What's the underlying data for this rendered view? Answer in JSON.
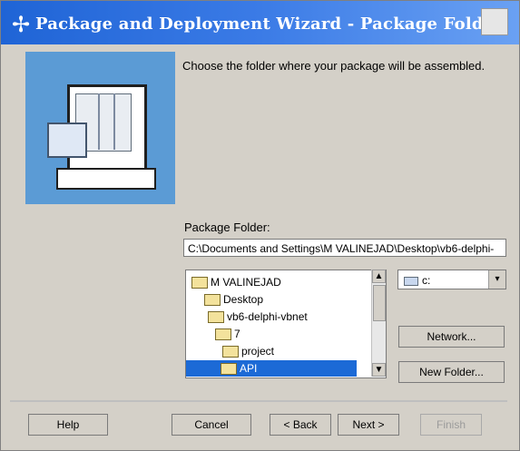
{
  "window": {
    "title": "Package and Deployment Wizard - Package Folder",
    "app_icon": "gear-plus-icon",
    "close_icon": "close-icon"
  },
  "content": {
    "instruction": "Choose the folder where your package will be assembled.",
    "package_folder_label": "Package Folder:",
    "package_folder_value": "C:\\Documents and Settings\\M VALINEJAD\\Desktop\\vb6-delphi-"
  },
  "tree": {
    "items": [
      {
        "label": "M VALINEJAD"
      },
      {
        "label": "Desktop"
      },
      {
        "label": "vb6-delphi-vbnet"
      },
      {
        "label": "7"
      },
      {
        "label": "project"
      },
      {
        "label": "API",
        "selected": true
      }
    ]
  },
  "drive": {
    "value": "c:",
    "icon": "drive-icon",
    "arrow": "▾"
  },
  "buttons": {
    "network": "Network...",
    "new_folder": "New Folder...",
    "help": "Help",
    "cancel": "Cancel",
    "back": "< Back",
    "next": "Next >",
    "finish": "Finish"
  }
}
